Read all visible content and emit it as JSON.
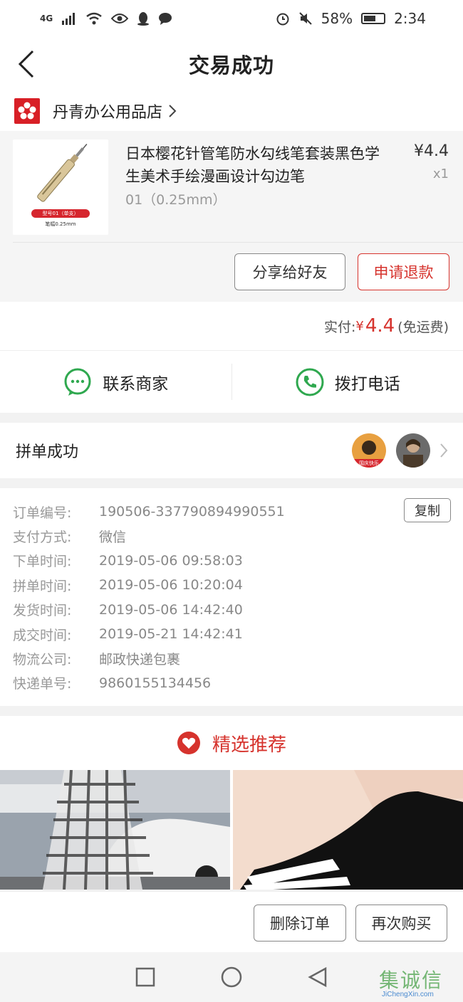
{
  "status_bar": {
    "network": "4G",
    "battery": "58%",
    "time": "2:34"
  },
  "header": {
    "title": "交易成功"
  },
  "shop": {
    "name": "丹青办公用品店"
  },
  "product": {
    "name": "日本樱花针管笔防水勾线笔套装黑色学生美术手绘漫画设计勾边笔",
    "spec": "01（0.25mm）",
    "price": "¥4.4",
    "quantity": "x1",
    "thumb_tag": "型号01（单支）",
    "thumb_caption": "笔幅0.25mm"
  },
  "buttons": {
    "share": "分享给好友",
    "refund": "申请退款",
    "copy": "复制",
    "delete": "删除订单",
    "rebuy": "再次购买"
  },
  "payment": {
    "label": "实付:",
    "currency": "¥",
    "amount": "4.4",
    "shipping": "(免运费)"
  },
  "contact": {
    "merchant": "联系商家",
    "phone": "拨打电话"
  },
  "group": {
    "label": "拼单成功",
    "avatar_caption": "国庆快乐"
  },
  "order_details": [
    {
      "label": "订单编号:",
      "value": "190506-337790894990551"
    },
    {
      "label": "支付方式:",
      "value": "微信"
    },
    {
      "label": "下单时间:",
      "value": "2019-05-06 09:58:03"
    },
    {
      "label": "拼单时间:",
      "value": "2019-05-06 10:20:04"
    },
    {
      "label": "发货时间:",
      "value": "2019-05-06 14:42:40"
    },
    {
      "label": "成交时间:",
      "value": "2019-05-21 14:42:41"
    },
    {
      "label": "物流公司:",
      "value": "邮政快递包裹"
    },
    {
      "label": "快递单号:",
      "value": "9860155134456"
    }
  ],
  "recommend": {
    "title": "精选推荐"
  },
  "watermark": {
    "text": "集诚信",
    "sub": "JiChengXin.com"
  },
  "colors": {
    "accent": "#d6332d",
    "wechat_green": "#2fa84f",
    "brand_red": "#d81f26"
  }
}
